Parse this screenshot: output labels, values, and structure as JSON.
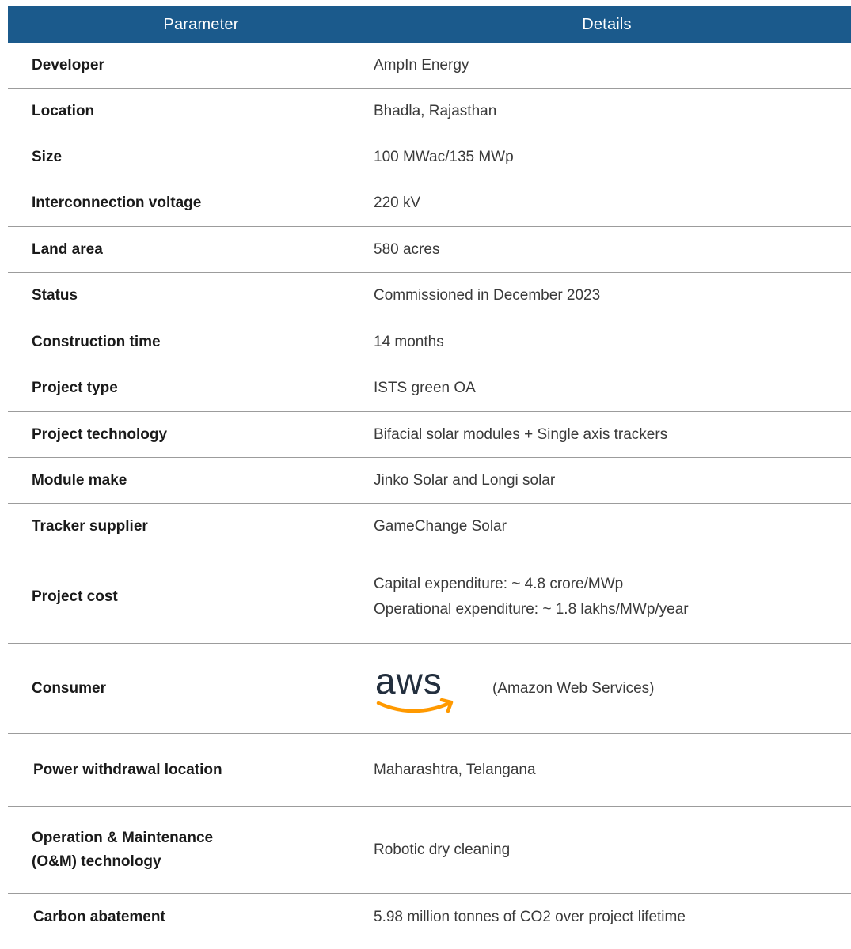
{
  "header": {
    "parameter": "Parameter",
    "details": "Details"
  },
  "rows": [
    {
      "parameter": "Developer",
      "details": "AmpIn Energy"
    },
    {
      "parameter": "Location",
      "details": "Bhadla, Rajasthan"
    },
    {
      "parameter": "Size",
      "details": "100 MWac/135 MWp"
    },
    {
      "parameter": "Interconnection voltage",
      "details": "220 kV"
    },
    {
      "parameter": "Land area",
      "details": "580 acres"
    },
    {
      "parameter": "Status",
      "details": "Commissioned in December 2023"
    },
    {
      "parameter": "Construction time",
      "details": "14 months"
    },
    {
      "parameter": "Project type",
      "details": "ISTS green OA"
    },
    {
      "parameter": "Project technology",
      "details": "Bifacial solar modules + Single axis trackers"
    },
    {
      "parameter": "Module make",
      "details": "Jinko Solar and Longi solar"
    },
    {
      "parameter": "Tracker supplier",
      "details": "GameChange Solar"
    },
    {
      "parameter": "Project cost",
      "details": [
        "Capital expenditure: ~ 4.8 crore/MWp",
        "Operational expenditure: ~ 1.8 lakhs/MWp/year"
      ]
    },
    {
      "parameter": "Consumer",
      "logo_text": "aws",
      "logo_color": "#232f3e",
      "smile_color": "#ff9900",
      "details": "(Amazon Web Services)"
    },
    {
      "parameter": "Power withdrawal location",
      "details": "Maharashtra, Telangana"
    },
    {
      "parameter": [
        "Operation & Maintenance",
        "(O&M) technology"
      ],
      "details": "Robotic dry cleaning"
    },
    {
      "parameter": "Carbon abatement",
      "details": "5.98 million tonnes of CO2 over project lifetime"
    }
  ],
  "colors": {
    "header_bg": "#1b5a8c",
    "row_divider": "#9c9c9c"
  }
}
